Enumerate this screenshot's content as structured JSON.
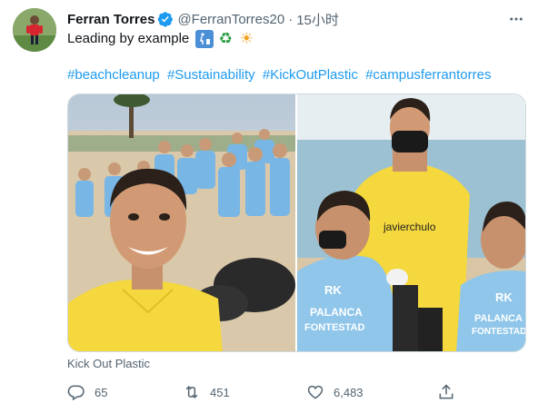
{
  "author": {
    "display_name": "Ferran Torres",
    "handle": "@FerranTorres20",
    "separator": "·",
    "time": "15小时",
    "verified": true
  },
  "tweet": {
    "text": "Leading by example",
    "emojis": [
      "put-litter-in-its-place-icon",
      "recycling-icon",
      "sun-icon"
    ],
    "hashtags": [
      "#beachcleanup",
      "#Sustainability",
      "#KickOutPlastic",
      "#campusferrantorres"
    ],
    "media_caption": "Kick Out Plastic"
  },
  "media_text": {
    "shirt_left": "PALANCA",
    "shirt_left_2": "FONTESTAD",
    "shirt_right": "PALANCA",
    "shirt_right_2": "FONTESTAD",
    "sponsor": "javierchulo",
    "rk": "RK"
  },
  "actions": {
    "reply_count": "65",
    "retweet_count": "451",
    "like_count": "6,483"
  },
  "colors": {
    "accent": "#1d9bf0",
    "text_primary": "#0f1419",
    "text_secondary": "#536471",
    "border": "#cfd9de"
  }
}
